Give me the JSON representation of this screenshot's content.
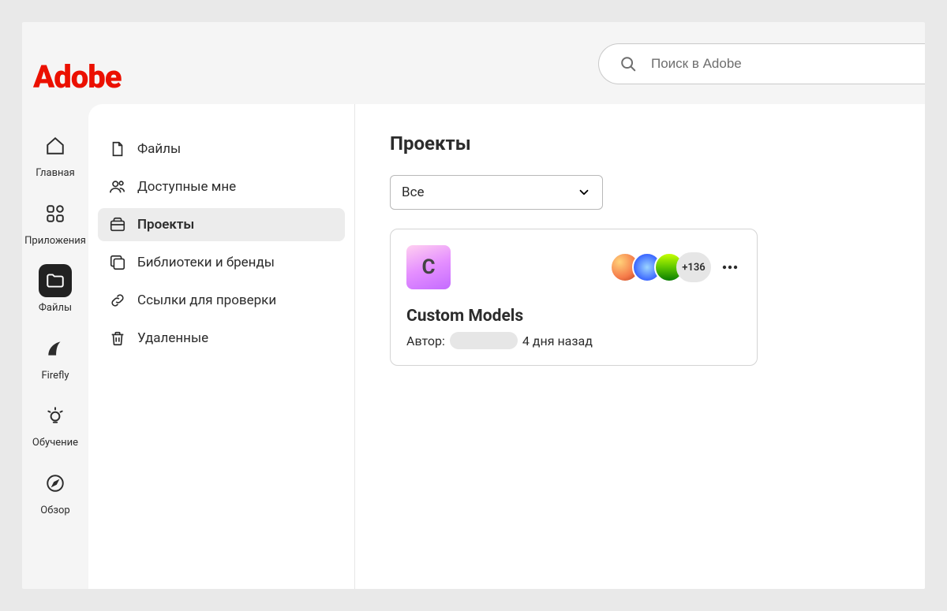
{
  "brand": "Adobe",
  "search": {
    "placeholder": "Поиск в Adobe"
  },
  "rail": {
    "items": [
      {
        "label": "Главная"
      },
      {
        "label": "Приложения"
      },
      {
        "label": "Файлы"
      },
      {
        "label": "Firefly"
      },
      {
        "label": "Обучение"
      },
      {
        "label": "Обзор"
      }
    ]
  },
  "sidebar": {
    "items": [
      {
        "label": "Файлы"
      },
      {
        "label": "Доступные мне"
      },
      {
        "label": "Проекты"
      },
      {
        "label": "Библиотеки и бренды"
      },
      {
        "label": "Ссылки для проверки"
      },
      {
        "label": "Удаленные"
      }
    ]
  },
  "main": {
    "title": "Проекты",
    "filter": {
      "selected": "Все"
    },
    "project": {
      "thumb_letter": "C",
      "title": "Custom Models",
      "author_label": "Автор:",
      "more_count": "+136",
      "time": "4 дня назад"
    }
  }
}
